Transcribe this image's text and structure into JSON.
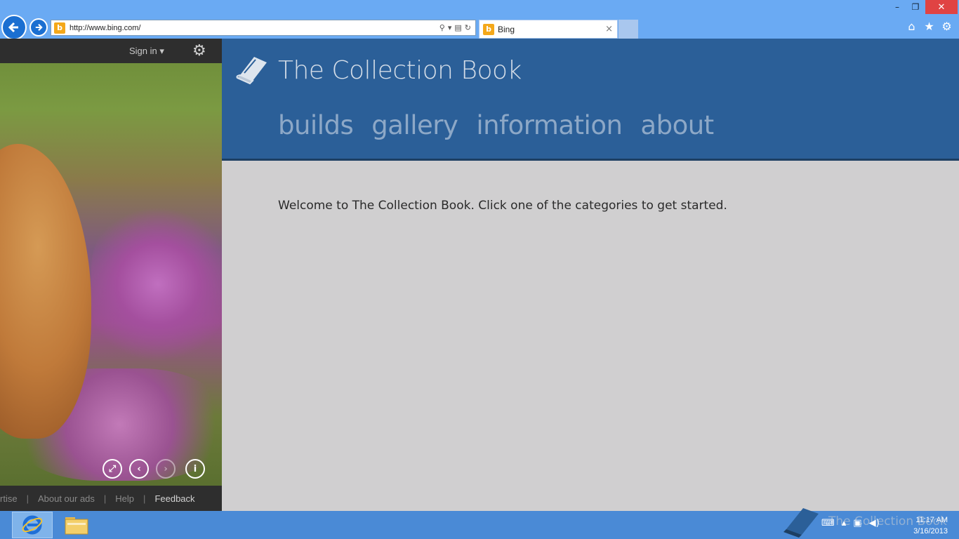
{
  "browser": {
    "url": "http://www.bing.com/",
    "tab_label": "Bing",
    "tab_close": "×",
    "window_min": "–",
    "window_restore": "❐",
    "window_close": "✕"
  },
  "bing": {
    "sign_in": "Sign in ▾",
    "footer": {
      "item1": "rtise",
      "sep": "|",
      "item2": "About our ads",
      "item3": "Help",
      "item4": "Feedback"
    }
  },
  "app": {
    "title": "The Collection Book",
    "nav": {
      "builds": "builds",
      "gallery": "gallery",
      "information": "information",
      "about": "about"
    },
    "welcome": "Welcome to The Collection Book. Click one of the categories to get started."
  },
  "taskbar": {
    "tray_app_name": "The Collection Book",
    "time": "11:17 AM",
    "date": "3/16/2013"
  },
  "colors": {
    "header_bg": "#2b5f98",
    "body_bg": "#d0cfd0",
    "chrome_bg": "#6aaaf3",
    "taskbar_bg": "#4a8ad6",
    "close_red": "#e04343"
  }
}
